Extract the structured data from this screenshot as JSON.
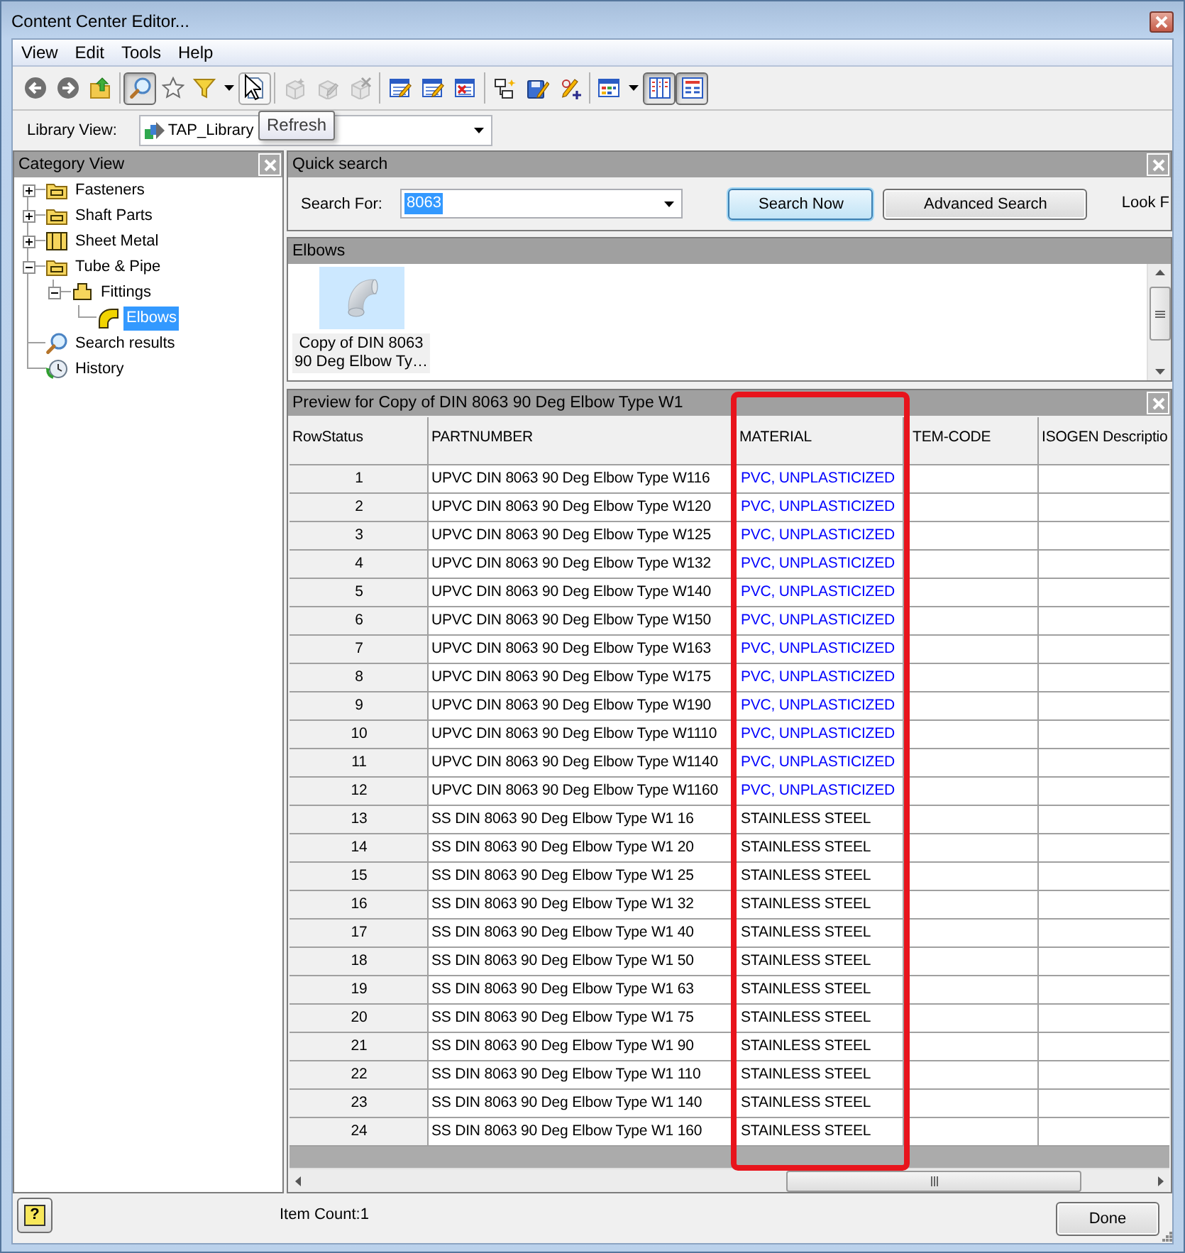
{
  "window": {
    "title": "Content Center Editor..."
  },
  "menu": [
    {
      "label": "View"
    },
    {
      "label": "Edit"
    },
    {
      "label": "Tools"
    },
    {
      "label": "Help"
    }
  ],
  "toolbar": {
    "groups": [
      [
        {
          "pressed": false,
          "disabled": false
        },
        {
          "pressed": false,
          "disabled": false
        },
        {
          "pressed": false,
          "disabled": false
        }
      ],
      [
        {
          "pressed": true,
          "disabled": false
        },
        {
          "pressed": false,
          "disabled": false
        },
        {
          "pressed": false,
          "disabled": false,
          "dropdown": true
        },
        {
          "pressed": false,
          "disabled": false,
          "hover": true,
          "tooltip": "Refresh"
        }
      ],
      [
        {
          "pressed": false,
          "disabled": true
        },
        {
          "pressed": false,
          "disabled": true
        },
        {
          "pressed": false,
          "disabled": true
        }
      ],
      [
        {
          "pressed": false,
          "disabled": false
        },
        {
          "pressed": false,
          "disabled": false
        },
        {
          "pressed": false,
          "disabled": false
        }
      ],
      [
        {
          "pressed": false,
          "disabled": false
        },
        {
          "pressed": false,
          "disabled": false
        },
        {
          "pressed": false,
          "disabled": false
        }
      ],
      [
        {
          "pressed": false,
          "disabled": false,
          "dropdown": true
        },
        {
          "pressed": true,
          "disabled": false
        },
        {
          "pressed": true,
          "disabled": false
        }
      ]
    ]
  },
  "library": {
    "label": "Library View:",
    "value": "TAP_Library"
  },
  "category_view": {
    "title": "Category View",
    "tree": [
      {
        "label": "Fasteners",
        "kind": "folder",
        "expanded": false,
        "selected": false
      },
      {
        "label": "Shaft Parts",
        "kind": "folder",
        "expanded": false,
        "selected": false
      },
      {
        "label": "Sheet Metal",
        "kind": "sheet",
        "expanded": false,
        "selected": false
      },
      {
        "label": "Tube & Pipe",
        "kind": "folder",
        "expanded": true,
        "selected": false,
        "children": [
          {
            "label": "Fittings",
            "kind": "fitting",
            "expanded": true,
            "selected": false,
            "children": [
              {
                "label": "Elbows",
                "kind": "elbow",
                "selected": true
              }
            ]
          }
        ]
      },
      {
        "label": "Search results",
        "kind": "search",
        "selected": false
      },
      {
        "label": "History",
        "kind": "history",
        "selected": false
      }
    ]
  },
  "quick_search": {
    "title": "Quick search",
    "label": "Search For:",
    "value": "8063",
    "value_selected": true,
    "buttons": [
      {
        "label": "Search Now",
        "default": true
      },
      {
        "label": "Advanced Search",
        "default": false
      }
    ],
    "look_label": "Look F"
  },
  "elbows": {
    "title": "Elbows",
    "items": [
      {
        "caption": "Copy of DIN 8063 90 Deg Elbow Ty…",
        "selected": true
      }
    ]
  },
  "preview": {
    "title": "Preview for Copy of DIN 8063 90 Deg Elbow Type W1",
    "columns": [
      {
        "label": "RowStatus",
        "highlighted": false
      },
      {
        "label": "PARTNUMBER",
        "highlighted": false
      },
      {
        "label": "MATERIAL",
        "highlighted": true
      },
      {
        "label": "TEM-CODE",
        "highlighted": false
      },
      {
        "label": "ISOGEN Descriptio",
        "highlighted": false
      }
    ],
    "rows": [
      {
        "cells": [
          "1",
          "UPVC DIN 8063 90 Deg Elbow Type W116",
          "PVC, UNPLASTICIZED"
        ],
        "color": "#0000ff"
      },
      {
        "cells": [
          "2",
          "UPVC DIN 8063 90 Deg Elbow Type W120",
          "PVC, UNPLASTICIZED"
        ],
        "color": "#0000ff"
      },
      {
        "cells": [
          "3",
          "UPVC DIN 8063 90 Deg Elbow Type W125",
          "PVC, UNPLASTICIZED"
        ],
        "color": "#0000ff"
      },
      {
        "cells": [
          "4",
          "UPVC DIN 8063 90 Deg Elbow Type W132",
          "PVC, UNPLASTICIZED"
        ],
        "color": "#0000ff"
      },
      {
        "cells": [
          "5",
          "UPVC DIN 8063 90 Deg Elbow Type W140",
          "PVC, UNPLASTICIZED"
        ],
        "color": "#0000ff"
      },
      {
        "cells": [
          "6",
          "UPVC DIN 8063 90 Deg Elbow Type W150",
          "PVC, UNPLASTICIZED"
        ],
        "color": "#0000ff"
      },
      {
        "cells": [
          "7",
          "UPVC DIN 8063 90 Deg Elbow Type W163",
          "PVC, UNPLASTICIZED"
        ],
        "color": "#0000ff"
      },
      {
        "cells": [
          "8",
          "UPVC DIN 8063 90 Deg Elbow Type W175",
          "PVC, UNPLASTICIZED"
        ],
        "color": "#0000ff"
      },
      {
        "cells": [
          "9",
          "UPVC DIN 8063 90 Deg Elbow Type W190",
          "PVC, UNPLASTICIZED"
        ],
        "color": "#0000ff"
      },
      {
        "cells": [
          "10",
          "UPVC DIN 8063 90 Deg Elbow Type W1110",
          "PVC, UNPLASTICIZED"
        ],
        "color": "#0000ff"
      },
      {
        "cells": [
          "11",
          "UPVC DIN 8063 90 Deg Elbow Type W1140",
          "PVC, UNPLASTICIZED"
        ],
        "color": "#0000ff"
      },
      {
        "cells": [
          "12",
          "UPVC DIN 8063 90 Deg Elbow Type W1160",
          "PVC, UNPLASTICIZED"
        ],
        "color": "#0000ff"
      },
      {
        "cells": [
          "13",
          "SS DIN 8063 90 Deg Elbow Type W1 16",
          "STAINLESS STEEL"
        ],
        "color": "#000000"
      },
      {
        "cells": [
          "14",
          "SS DIN 8063 90 Deg Elbow Type W1 20",
          "STAINLESS STEEL"
        ],
        "color": "#000000"
      },
      {
        "cells": [
          "15",
          "SS DIN 8063 90 Deg Elbow Type W1 25",
          "STAINLESS STEEL"
        ],
        "color": "#000000"
      },
      {
        "cells": [
          "16",
          "SS DIN 8063 90 Deg Elbow Type W1 32",
          "STAINLESS STEEL"
        ],
        "color": "#000000"
      },
      {
        "cells": [
          "17",
          "SS DIN 8063 90 Deg Elbow Type W1 40",
          "STAINLESS STEEL"
        ],
        "color": "#000000"
      },
      {
        "cells": [
          "18",
          "SS DIN 8063 90 Deg Elbow Type W1 50",
          "STAINLESS STEEL"
        ],
        "color": "#000000"
      },
      {
        "cells": [
          "19",
          "SS DIN 8063 90 Deg Elbow Type W1 63",
          "STAINLESS STEEL"
        ],
        "color": "#000000"
      },
      {
        "cells": [
          "20",
          "SS DIN 8063 90 Deg Elbow Type W1 75",
          "STAINLESS STEEL"
        ],
        "color": "#000000"
      },
      {
        "cells": [
          "21",
          "SS DIN 8063 90 Deg Elbow Type W1 90",
          "STAINLESS STEEL"
        ],
        "color": "#000000"
      },
      {
        "cells": [
          "22",
          "SS DIN 8063 90 Deg Elbow Type W1 110",
          "STAINLESS STEEL"
        ],
        "color": "#000000"
      },
      {
        "cells": [
          "23",
          "SS DIN 8063 90 Deg Elbow Type W1 140",
          "STAINLESS STEEL"
        ],
        "color": "#000000"
      },
      {
        "cells": [
          "24",
          "SS DIN 8063 90 Deg Elbow Type W1 160",
          "STAINLESS STEEL"
        ],
        "color": "#000000"
      }
    ]
  },
  "footer": {
    "help_symbol": "?",
    "item_count": "Item Count:1",
    "done": "Done"
  }
}
